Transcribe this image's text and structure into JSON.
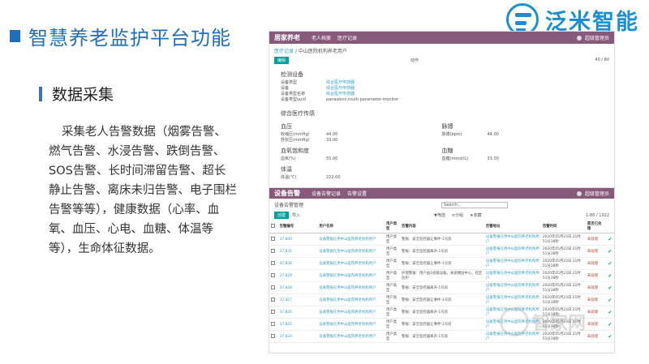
{
  "slide": {
    "title": "智慧养老监护平台功能",
    "logo_text": "泛米智能",
    "sub_heading": "数据采集",
    "description": "采集老人告警数据（烟雾告警、燃气告警、水浸告警、跌倒告警、SOS告警、长时间滞留告警、超长静止告警、离床未归告警、电子围栏告警等等），健康数据（心率、血氧、血压、心电、血糖、体温等等），生命体征数据。",
    "watermark": "智家网"
  },
  "app1": {
    "brand": "居家养老",
    "menus": [
      "老人档案",
      "医疗记录"
    ],
    "user": "超级管理员",
    "breadcrumb_link": "医疗记录",
    "breadcrumb_current": "中山医院机构养老用户",
    "edit_label": "编辑",
    "action_label": "动作",
    "pager": "40 / 80",
    "detect_section": "检测设备",
    "device_rows": [
      {
        "k": "设备类型",
        "v": "综合医疗传感器"
      },
      {
        "k": "设备",
        "v": "综合医疗传感器"
      },
      {
        "k": "设备类型名称",
        "v": "综合医疗传感器"
      },
      {
        "k": "设备类型uuid",
        "v": "panasonic.multi-parameter-monitor"
      }
    ],
    "sensor_section": "综合医疗传感",
    "bp_title": "血压",
    "bp_rows": [
      {
        "k": "收缩压(mmHg)",
        "v": "44.00"
      },
      {
        "k": "舒张压(mmHg)",
        "v": "33.00"
      }
    ],
    "pulse_title": "脉搏",
    "pulse_rows": [
      {
        "k": "脉搏(bpm)",
        "v": "44.00"
      }
    ],
    "spo2_title": "血氧饱和度",
    "spo2_rows": [
      {
        "k": "血氧(%)",
        "v": "55.00"
      }
    ],
    "glucose_title": "血糖",
    "glucose_rows": [
      {
        "k": "血糖(mmol/L)",
        "v": "33.00"
      }
    ],
    "temp_title": "体温",
    "temp_rows": [
      {
        "k": "体温(℃)",
        "v": "222.00"
      }
    ]
  },
  "app2": {
    "brand": "设备告警",
    "menus": [
      "设备告警记录",
      "告警设置"
    ],
    "user": "超级管理员",
    "page_title": "设备告警管理",
    "search_placeholder": "Search...",
    "create_label": "创建",
    "import_label": "导入",
    "filters": [
      "▼筛选",
      "≡分组",
      "★收藏"
    ],
    "pager": "1-80 / 1922",
    "columns": [
      "告警编号",
      "用户名称",
      "用户类型",
      "告警内容",
      "告警地址",
      "告警时间",
      "是否已处理"
    ],
    "rows": [
      [
        "37,800",
        "设备警报在用中山医院养老机构用户",
        "用户类型",
        "警报：安全监控器让事件-1号房",
        "设备警报在用中山医院养老机构用户",
        "2020年05月23日 21时51分38秒",
        "未处理"
      ],
      [
        "37,831",
        "设备警报在用中山医院养老机构用户",
        "用户类型",
        "警报：安全监控器离开-1号房",
        "设备警报在用中山医院养老机构用户",
        "2020年05月23日 21时51分38秒",
        "未处理"
      ],
      [
        "37,836",
        "设备警报在用中山医院养老机构用户",
        "用户类型",
        "警报：安全监控器让事件-1号房",
        "设备警报在用中山医院养老机构用户",
        "2020年05月23日 21时51分38秒",
        "未处理"
      ],
      [
        "37,829",
        "设备警报在用中山医院养老机构用户",
        "用户类型",
        "护理警报：用户由1初级设备，关爱楼层中心，社区监护",
        "设备警报在用中山医院养老机构用户",
        "2020年05月23日 21时51分38秒",
        "未处理"
      ],
      [
        "37,828",
        "设备警报在用中山医院养老机构用户",
        "用户类型",
        "警报：安全监控器离开-1号房",
        "设备警报在用中山医院养老机构用户",
        "2020年05月23日 21时51分38秒",
        "未处理"
      ],
      [
        "37,827",
        "设备警报在用中山医院养老机构用户",
        "用户类型",
        "警报：安全监控器让事件-1号房",
        "设备警报在用中山医院养老机构用户",
        "2020年05月23日 21时51分38秒",
        "未处理"
      ],
      [
        "37,826",
        "设备警报在用中山医院养老机构用户",
        "用户类型",
        "警报：安全监控器离开-1号房",
        "设备警报在用中山医院养老机构用户",
        "2020年05月23日 21时51分38秒",
        "未处理"
      ],
      [
        "37,825",
        "设备警报在用中山医院养老机构用户",
        "用户类型",
        "警报：安全监控器让事件-1号房",
        "设备警报在用中山医院养老机构用户",
        "2020年05月23日 21时51分38秒",
        "未处理"
      ],
      [
        "37,824",
        "设备警报在用中山医院养老机构用户",
        "用户类型",
        "警报：安全监控器离开-1号房",
        "设备警报在用中山医院养老机构用户",
        "2020年05月23日 21时51分38秒",
        "未处理"
      ]
    ]
  },
  "colors": {
    "title_blue": "#1e6fb8",
    "odoo_purple": "#875a7b",
    "odoo_teal": "#00a09d",
    "link_blue": "#3a9fc0"
  }
}
